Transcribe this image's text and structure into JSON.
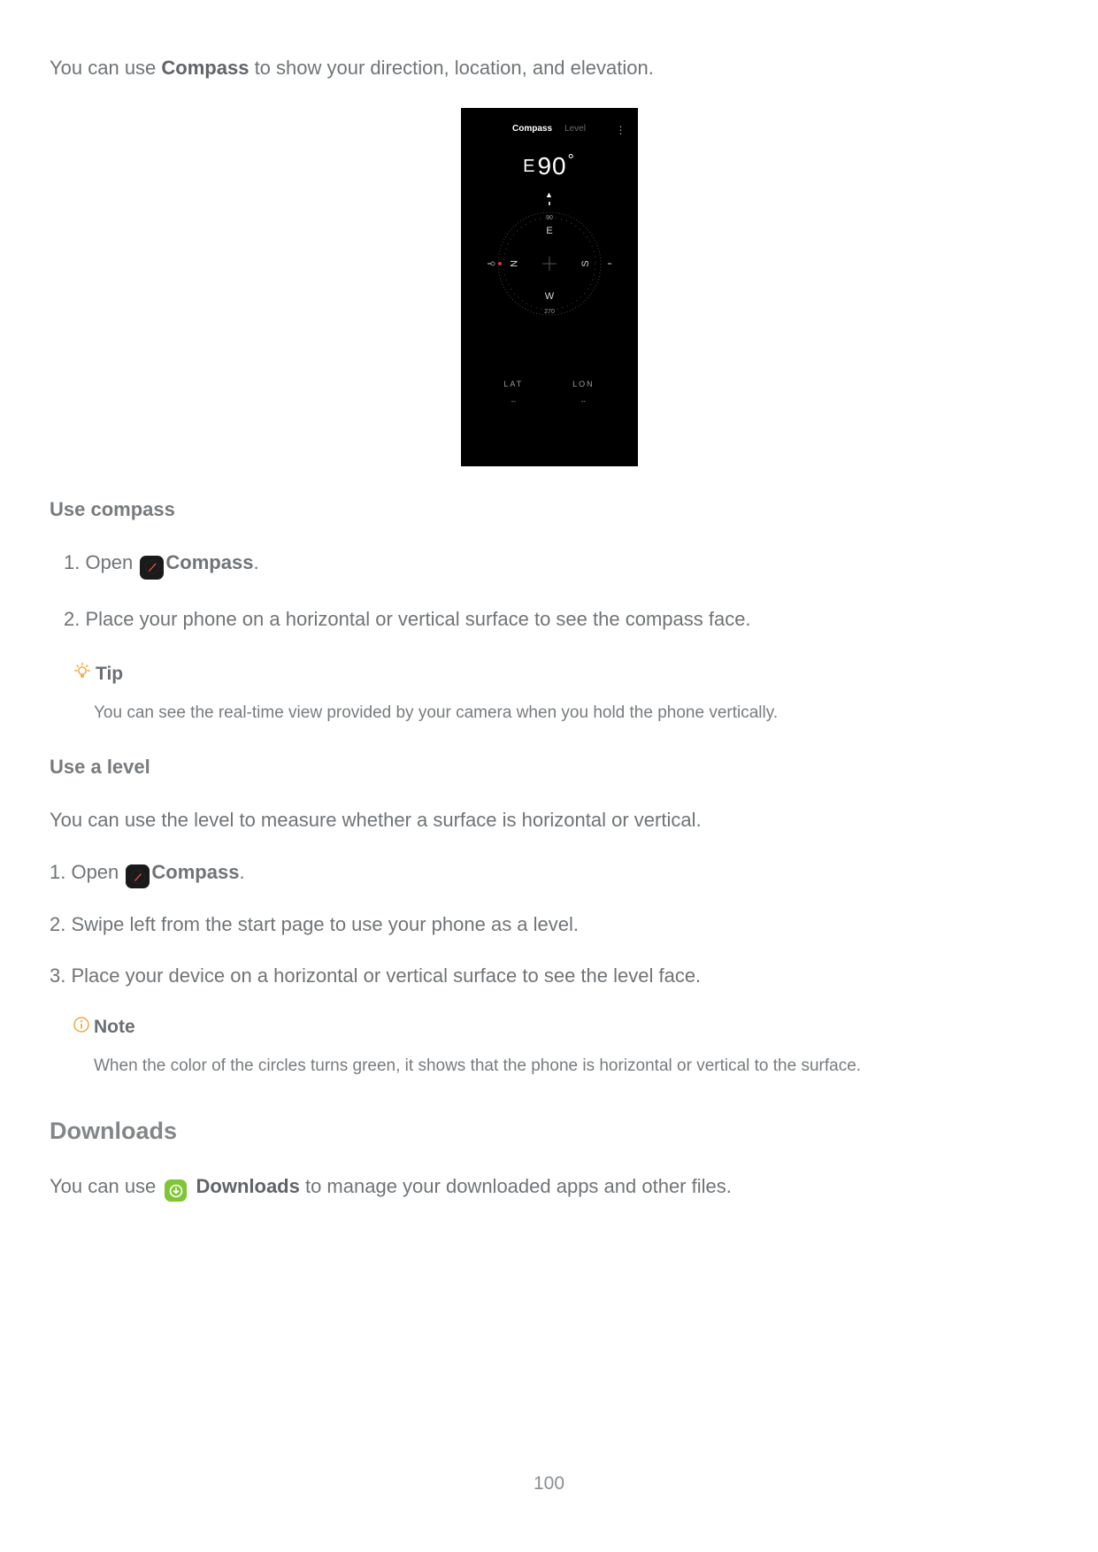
{
  "intro": {
    "pre": "You can use ",
    "bold": "Compass",
    "post": " to show your direction, location, and elevation."
  },
  "phone": {
    "tab_compass": "Compass",
    "tab_level": "Level",
    "heading_dir": "E",
    "heading_deg": "90",
    "heading_sym": "°",
    "lat_label": "LAT",
    "lon_label": "LON",
    "lat_value": "--",
    "lon_value": "--",
    "tick_90": "90",
    "tick_270": "270",
    "card_n": "N",
    "card_e": "E",
    "card_s": "S",
    "card_w": "W"
  },
  "section_use_compass": "Use compass",
  "steps_compass": {
    "s1_pre": "1. Open ",
    "s1_app": "Compass",
    "s1_post": ".",
    "s2": "2. Place your phone on a horizontal or vertical surface to see the compass face."
  },
  "tip": {
    "label": "Tip",
    "body": "You can see the real-time view provided by your camera when you hold the phone vertically."
  },
  "section_use_level": "Use a level",
  "level_intro": "You can use the level to measure whether a surface is horizontal or vertical.",
  "steps_level": {
    "s1_pre": "1. Open ",
    "s1_app": "Compass",
    "s1_post": ".",
    "s2": "2. Swipe left from the start page to use your phone as a level.",
    "s3": "3. Place your device on a horizontal or vertical surface to see the level face."
  },
  "note": {
    "label": "Note",
    "body": "When the color of the circles turns green, it shows that the phone is horizontal or vertical to the surface."
  },
  "section_downloads": "Downloads",
  "downloads_intro": {
    "pre": "You can use ",
    "bold": " Downloads",
    "post": " to manage your downloaded apps and other files."
  },
  "page_number": "100"
}
